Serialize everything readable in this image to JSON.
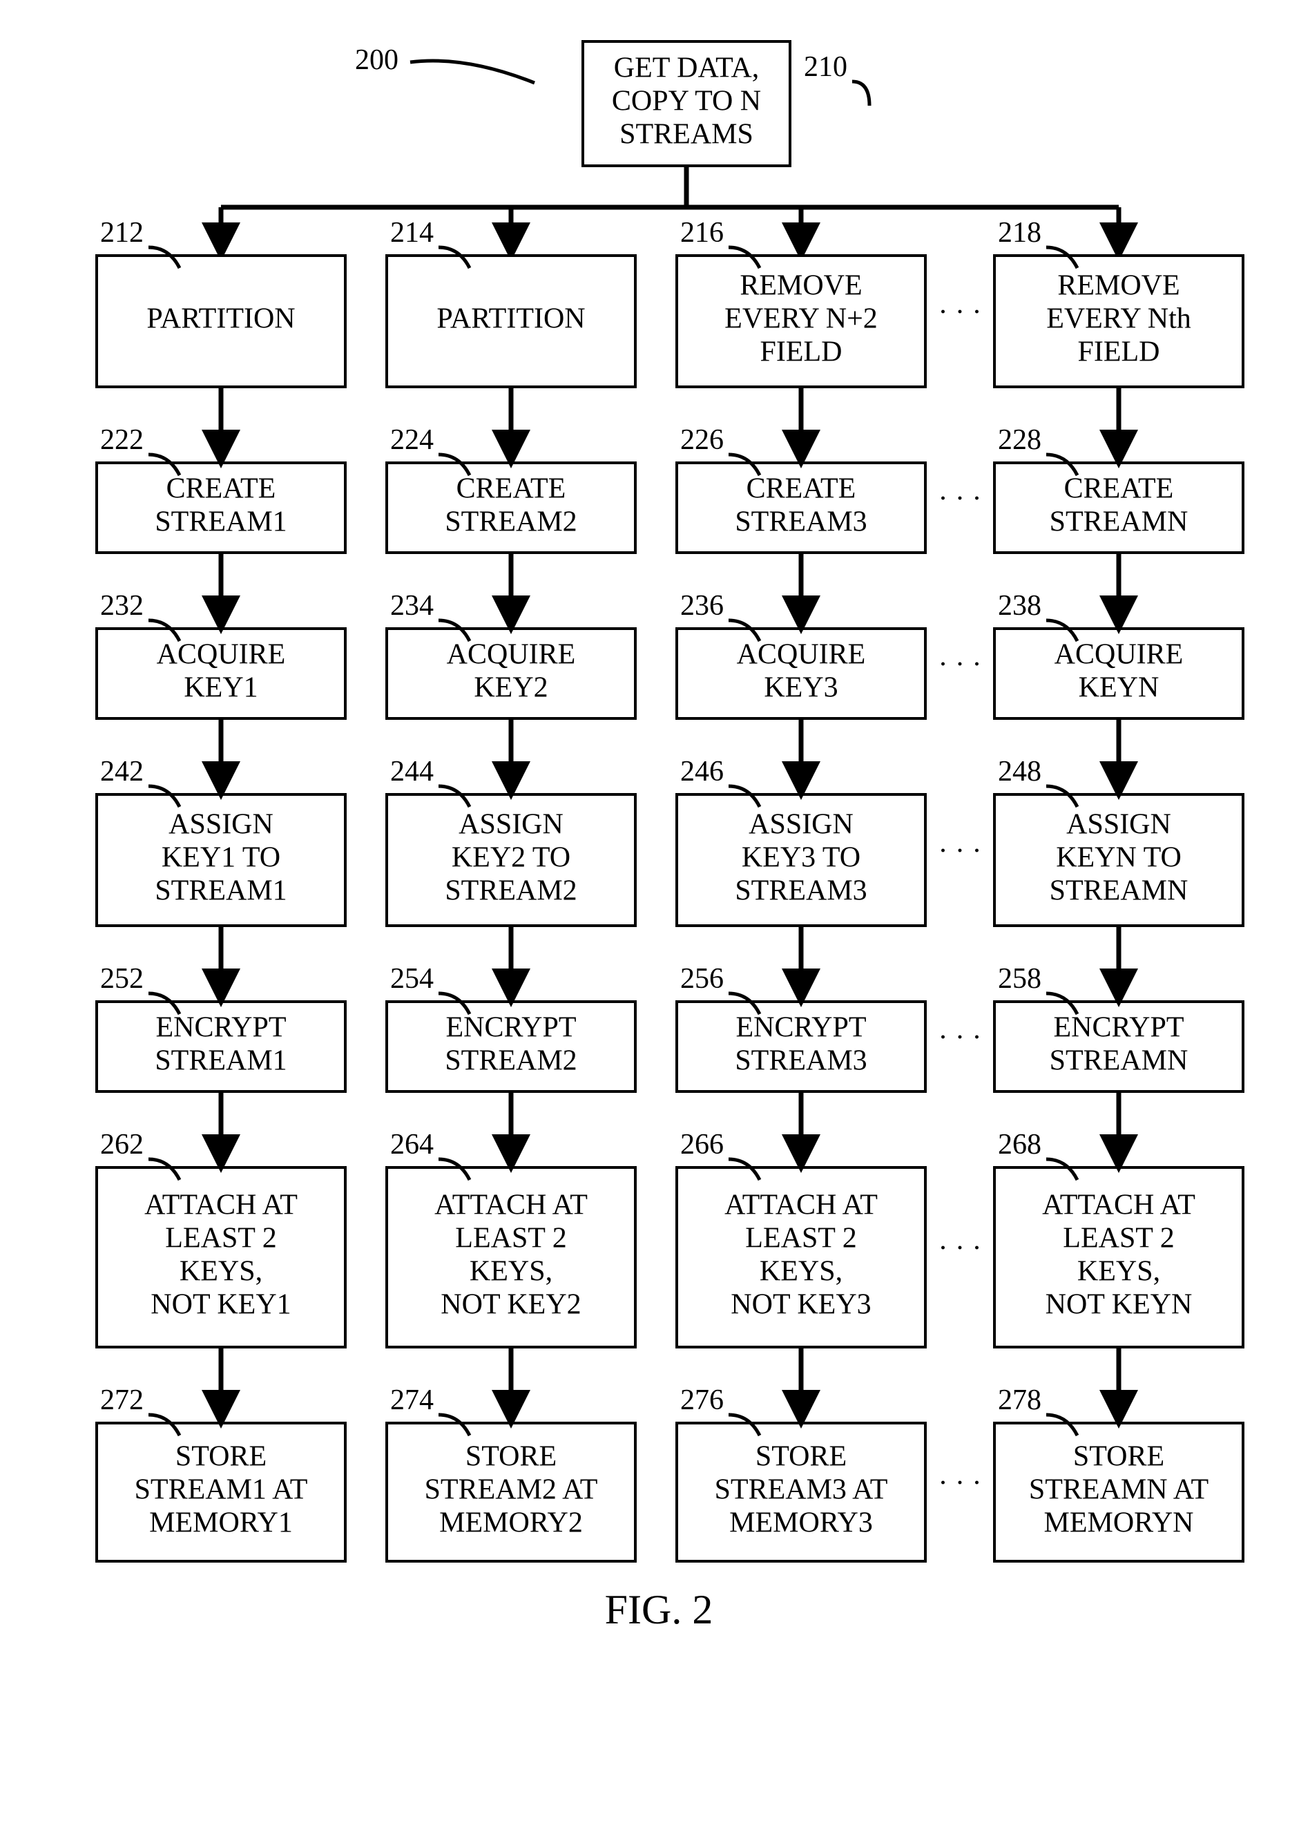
{
  "figureRef": "200",
  "figureLabel": "FIG. 2",
  "top": {
    "ref": "210",
    "lines": [
      "GET DATA,",
      "COPY TO N",
      "STREAMS"
    ]
  },
  "rows": [
    {
      "refs": [
        "212",
        "214",
        "216",
        "218"
      ],
      "cells": [
        [
          "PARTITION"
        ],
        [
          "PARTITION"
        ],
        [
          "REMOVE",
          "EVERY N+2",
          "FIELD"
        ],
        [
          "REMOVE",
          "EVERY Nth",
          "FIELD"
        ]
      ]
    },
    {
      "refs": [
        "222",
        "224",
        "226",
        "228"
      ],
      "cells": [
        [
          "CREATE",
          "STREAM1"
        ],
        [
          "CREATE",
          "STREAM2"
        ],
        [
          "CREATE",
          "STREAM3"
        ],
        [
          "CREATE",
          "STREAMN"
        ]
      ]
    },
    {
      "refs": [
        "232",
        "234",
        "236",
        "238"
      ],
      "cells": [
        [
          "ACQUIRE",
          "KEY1"
        ],
        [
          "ACQUIRE",
          "KEY2"
        ],
        [
          "ACQUIRE",
          "KEY3"
        ],
        [
          "ACQUIRE",
          "KEYN"
        ]
      ]
    },
    {
      "refs": [
        "242",
        "244",
        "246",
        "248"
      ],
      "cells": [
        [
          "ASSIGN",
          "KEY1 TO",
          "STREAM1"
        ],
        [
          "ASSIGN",
          "KEY2 TO",
          "STREAM2"
        ],
        [
          "ASSIGN",
          "KEY3 TO",
          "STREAM3"
        ],
        [
          "ASSIGN",
          "KEYN TO",
          "STREAMN"
        ]
      ]
    },
    {
      "refs": [
        "252",
        "254",
        "256",
        "258"
      ],
      "cells": [
        [
          "ENCRYPT",
          "STREAM1"
        ],
        [
          "ENCRYPT",
          "STREAM2"
        ],
        [
          "ENCRYPT",
          "STREAM3"
        ],
        [
          "ENCRYPT",
          "STREAMN"
        ]
      ]
    },
    {
      "refs": [
        "262",
        "264",
        "266",
        "268"
      ],
      "cells": [
        [
          "ATTACH AT",
          "LEAST 2",
          "KEYS,",
          "NOT KEY1"
        ],
        [
          "ATTACH AT",
          "LEAST 2",
          "KEYS,",
          "NOT KEY2"
        ],
        [
          "ATTACH AT",
          "LEAST 2",
          "KEYS,",
          "NOT KEY3"
        ],
        [
          "ATTACH AT",
          "LEAST 2",
          "KEYS,",
          "NOT KEYN"
        ]
      ]
    },
    {
      "refs": [
        "272",
        "274",
        "276",
        "278"
      ],
      "cells": [
        [
          "STORE",
          "STREAM1 AT",
          "MEMORY1"
        ],
        [
          "STORE",
          "STREAM2 AT",
          "MEMORY2"
        ],
        [
          "STORE",
          "STREAM3 AT",
          "MEMORY3"
        ],
        [
          "STORE",
          "STREAMN AT",
          "MEMORYN"
        ]
      ]
    }
  ]
}
